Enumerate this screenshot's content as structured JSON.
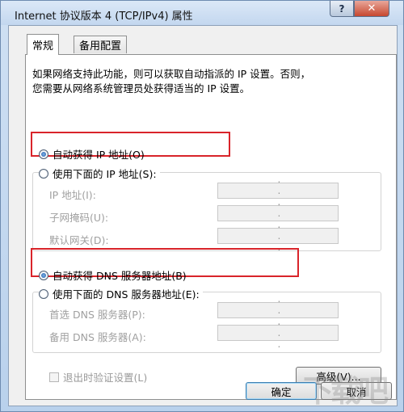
{
  "window": {
    "title": "Internet 协议版本 4 (TCP/IPv4) 属性",
    "help_label": "?",
    "close_label": "✕"
  },
  "tabs": [
    {
      "label": "常规",
      "active": true
    },
    {
      "label": "备用配置",
      "active": false
    }
  ],
  "description": {
    "line1": "如果网络支持此功能，则可以获取自动指派的 IP 设置。否则，",
    "line2": "您需要从网络系统管理员处获得适当的 IP 设置。"
  },
  "ip": {
    "auto_label": "自动获得 IP 地址(O)",
    "manual_label": "使用下面的 IP 地址(S):",
    "selected": "auto",
    "fields": [
      {
        "label": "IP 地址(I):",
        "value": ". . ."
      },
      {
        "label": "子网掩码(U):",
        "value": ". . ."
      },
      {
        "label": "默认网关(D):",
        "value": ". . ."
      }
    ]
  },
  "dns": {
    "auto_label": "自动获得 DNS 服务器地址(B)",
    "manual_label": "使用下面的 DNS 服务器地址(E):",
    "selected": "auto",
    "fields": [
      {
        "label": "首选 DNS 服务器(P):",
        "value": ". . ."
      },
      {
        "label": "备用 DNS 服务器(A):",
        "value": ". . ."
      }
    ]
  },
  "validate_label": "退出时验证设置(L)",
  "validate_checked": false,
  "advanced_label": "高级(V)...",
  "ok_label": "确定",
  "cancel_label": "取消",
  "watermark": "下载吧",
  "colors": {
    "highlight_box": "#d9242a",
    "title_bar": "#c3d7ef"
  }
}
